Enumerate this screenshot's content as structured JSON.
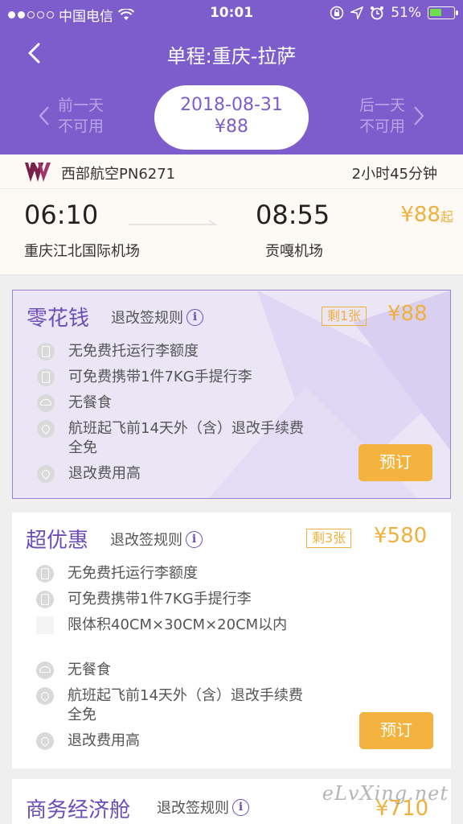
{
  "status_bar": {
    "carrier": "中国电信",
    "time": "10:01",
    "battery_pct": "51%",
    "battery_level": 0.51
  },
  "nav": {
    "title": "单程:重庆-拉萨"
  },
  "day_selector": {
    "prev_label": "前一天",
    "prev_status": "不可用",
    "current_date": "2018-08-31",
    "current_price": "¥88",
    "next_label": "后一天",
    "next_status": "不可用"
  },
  "flight": {
    "airline": "西部航空PN6271",
    "duration": "2小时45分钟",
    "dep_time": "06:10",
    "arr_time": "08:55",
    "dep_airport": "重庆江北国际机场",
    "arr_airport": "贡嘎机场",
    "lowest_price": "¥88",
    "lowest_suffix": "起"
  },
  "cabins": [
    {
      "name": "零花钱",
      "rule_label": "退改签规则",
      "left": "剩1张",
      "price": "¥88",
      "book_label": "预订",
      "features": [
        {
          "icon": "luggage-icon",
          "text": "无免费托运行李额度"
        },
        {
          "icon": "carry-on-icon",
          "text": "可免费携带1件7KG手提行李"
        },
        {
          "icon": "meal-icon",
          "text": "无餐食"
        },
        {
          "icon": "heart-icon",
          "text": "航班起飞前14天外（含）退改手续费全免"
        },
        {
          "icon": "heart-icon",
          "text": "退改费用高"
        }
      ]
    },
    {
      "name": "超优惠",
      "rule_label": "退改签规则",
      "left": "剩3张",
      "price": "¥580",
      "book_label": "预订",
      "features": [
        {
          "icon": "luggage-icon",
          "text": "无免费托运行李额度"
        },
        {
          "icon": "carry-on-icon",
          "text": "可免费携带1件7KG手提行李"
        },
        {
          "icon": "blank-icon",
          "text": "限体积40CM×30CM×20CM以内"
        },
        {
          "icon": "meal-icon",
          "text": "无餐食"
        },
        {
          "icon": "heart-icon",
          "text": "航班起飞前14天外（含）退改手续费全免"
        },
        {
          "icon": "heart-icon",
          "text": "退改费用高"
        }
      ]
    },
    {
      "name": "商务经济舱",
      "rule_label": "退改签规则",
      "price": "¥710"
    }
  ],
  "watermark": "eLvXing.net",
  "colors": {
    "brand": "#7d5ccc",
    "accent": "#f4b33e",
    "price": "#f0b13c"
  }
}
